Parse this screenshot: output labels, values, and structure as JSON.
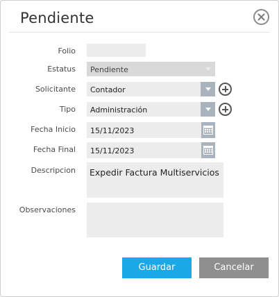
{
  "dialog": {
    "title": "Pendiente",
    "close_icon": "close-circle-icon"
  },
  "form": {
    "folio": {
      "label": "Folio",
      "value": ""
    },
    "estatus": {
      "label": "Estatus",
      "value": "Pendiente"
    },
    "solicitante": {
      "label": "Solicitante",
      "value": "Contador"
    },
    "tipo": {
      "label": "Tipo",
      "value": "Administración"
    },
    "fecha_inicio": {
      "label": "Fecha Inicio",
      "value": "15/11/2023"
    },
    "fecha_final": {
      "label": "Fecha Final",
      "value": "15/11/2023"
    },
    "descripcion": {
      "label": "Descripcion",
      "value": "Expedir Factura Multiservicios"
    },
    "observaciones": {
      "label": "Observaciones",
      "value": ""
    }
  },
  "buttons": {
    "save_label": "Guardar",
    "cancel_label": "Cancelar"
  },
  "colors": {
    "save": "#1aa8e8",
    "cancel": "#8f8f8f",
    "field_bg": "#ececec",
    "button_addon": "#a8b3be"
  }
}
